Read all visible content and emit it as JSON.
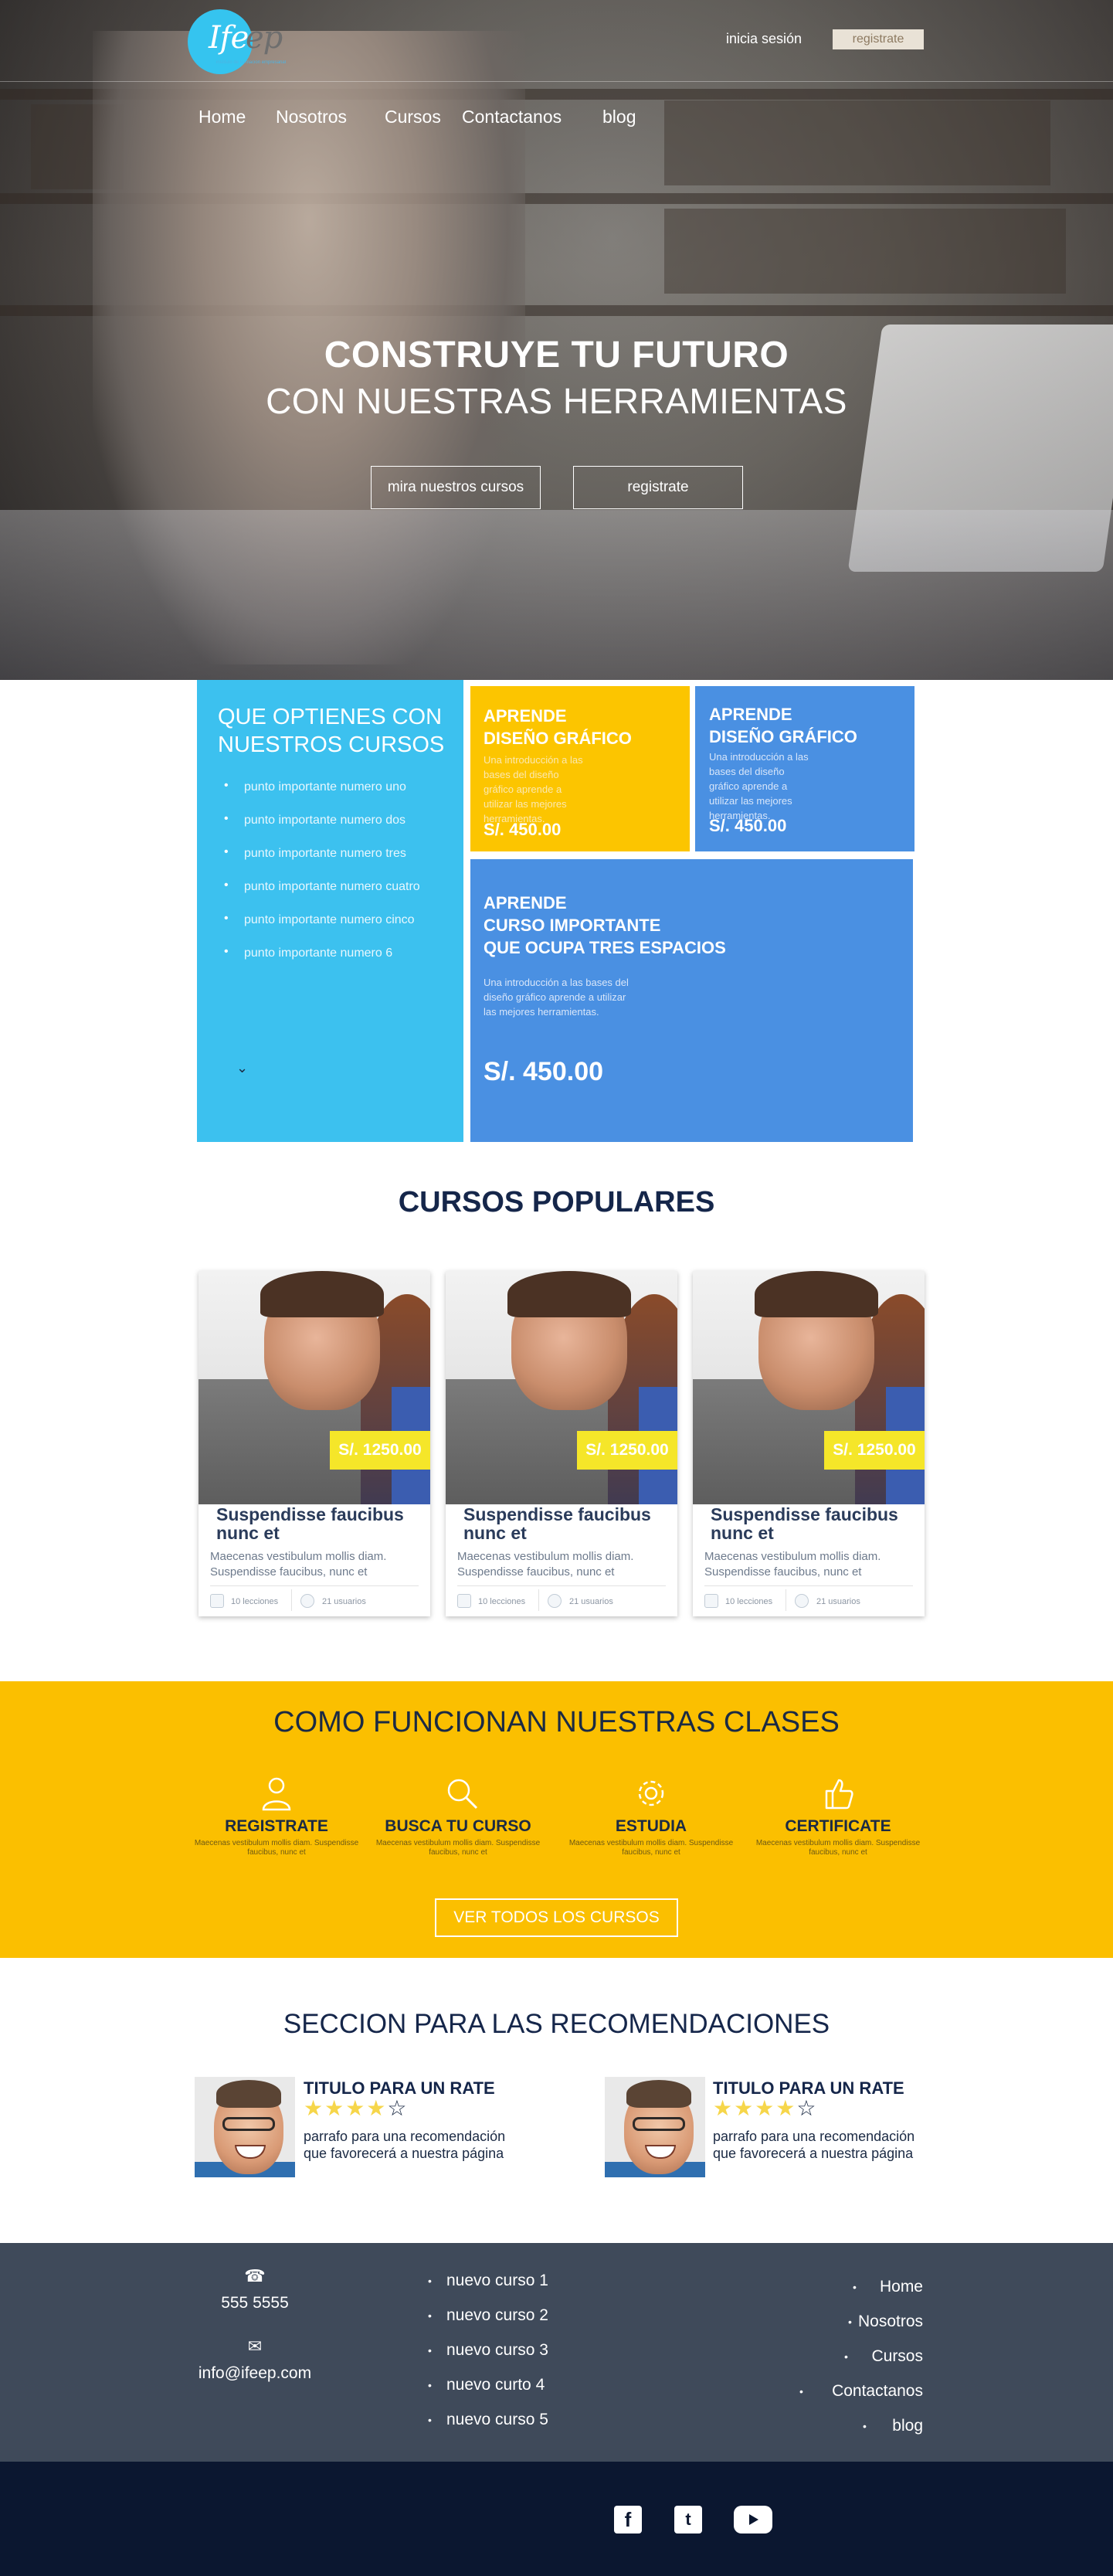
{
  "header": {
    "logo_main": "Ife",
    "logo_accent": "ep",
    "logo_sub": "instituto de formación empresarial",
    "login_label": "inicia sesión",
    "register_label": "registrate",
    "nav": [
      "Home",
      "Nosotros",
      "Cursos",
      "Contactanos",
      "blog"
    ]
  },
  "hero": {
    "title_line1": "CONSTRUYE TU FUTURO",
    "title_line2": "CON NUESTRAS HERRAMIENTAS",
    "btn_courses": "mira nuestros cursos",
    "btn_register": "registrate"
  },
  "features": {
    "title": "QUE OPTIENES CON NUESTROS CURSOS",
    "items": [
      "punto importante numero uno",
      "punto importante numero dos",
      "punto importante numero tres",
      "punto importante numero cuatro",
      "punto importante numero cinco",
      "punto importante numero 6"
    ],
    "chevron": "⌄",
    "cards": [
      {
        "kicker": "APRENDE",
        "title": "DISEÑO GRÁFICO",
        "desc": "Una introducción a las bases del diseño gráfico aprende a utilizar las mejores herramientas.",
        "price": "S/. 450.00",
        "color": "#fcc500"
      },
      {
        "kicker": "APRENDE",
        "title": "DISEÑO GRÁFICO",
        "desc": "Una introducción a las bases del diseño gráfico aprende a utilizar las mejores herramientas.",
        "price": "S/. 450.00",
        "color": "#4a90e2"
      },
      {
        "kicker": "APRENDE",
        "title": "CURSO IMPORTANTE",
        "title2": "QUE OCUPA TRES ESPACIOS",
        "desc": "Una introducción a las bases del diseño gráfico aprende a utilizar las mejores herramientas.",
        "price": "S/. 450.00",
        "color": "#4a90e2"
      }
    ]
  },
  "popular": {
    "title": "CURSOS POPULARES",
    "courses": [
      {
        "price": "S/. 1250.00",
        "title": "Suspendisse faucibus nunc et",
        "desc": "Maecenas vestibulum mollis diam. Suspendisse faucibus, nunc et",
        "lessons": "10 lecciones",
        "users": "21 usuarios"
      },
      {
        "price": "S/. 1250.00",
        "title": "Suspendisse faucibus nunc et",
        "desc": "Maecenas vestibulum mollis diam. Suspendisse faucibus, nunc et",
        "lessons": "10 lecciones",
        "users": "21 usuarios"
      },
      {
        "price": "S/. 1250.00",
        "title": "Suspendisse faucibus nunc et",
        "desc": "Maecenas vestibulum mollis diam. Suspendisse faucibus, nunc et",
        "lessons": "10 lecciones",
        "users": "21 usuarios"
      }
    ]
  },
  "how": {
    "title": "COMO FUNCIONAN NUESTRAS CLASES",
    "steps": [
      {
        "icon": "user-icon",
        "title": "REGISTRATE",
        "desc": "Maecenas vestibulum mollis diam. Suspendisse faucibus, nunc et"
      },
      {
        "icon": "search-icon",
        "title": "BUSCA TU CURSO",
        "desc": "Maecenas vestibulum mollis diam. Suspendisse faucibus, nunc et"
      },
      {
        "icon": "gear-icon",
        "title": "ESTUDIA",
        "desc": "Maecenas vestibulum mollis diam. Suspendisse faucibus, nunc et"
      },
      {
        "icon": "thumbs-up-icon",
        "title": "CERTIFICATE",
        "desc": "Maecenas vestibulum mollis diam. Suspendisse faucibus, nunc et"
      }
    ],
    "button": "VER TODOS LOS CURSOS",
    "color": "#fbbf00"
  },
  "recommendations": {
    "title": "SECCION PARA LAS RECOMENDACIONES",
    "items": [
      {
        "title": "TITULO PARA UN RATE",
        "rating": 4,
        "text": "parrafo para una recomendación que favorecerá a nuestra página"
      },
      {
        "title": "TITULO PARA UN RATE",
        "rating": 4,
        "text": "parrafo para una recomendación que favorecerá a nuestra página"
      }
    ]
  },
  "footer": {
    "phone": "555 5555",
    "email": "info@ifeep.com",
    "courses": [
      "nuevo curso 1",
      "nuevo curso 2",
      "nuevo curso 3",
      "nuevo curto 4",
      "nuevo curso 5"
    ],
    "nav": [
      "Home",
      "Nosotros",
      "Cursos",
      "Contactanos",
      "blog"
    ],
    "social": {
      "facebook": "f",
      "twitter": "t"
    },
    "color": "#3f4a5a"
  }
}
